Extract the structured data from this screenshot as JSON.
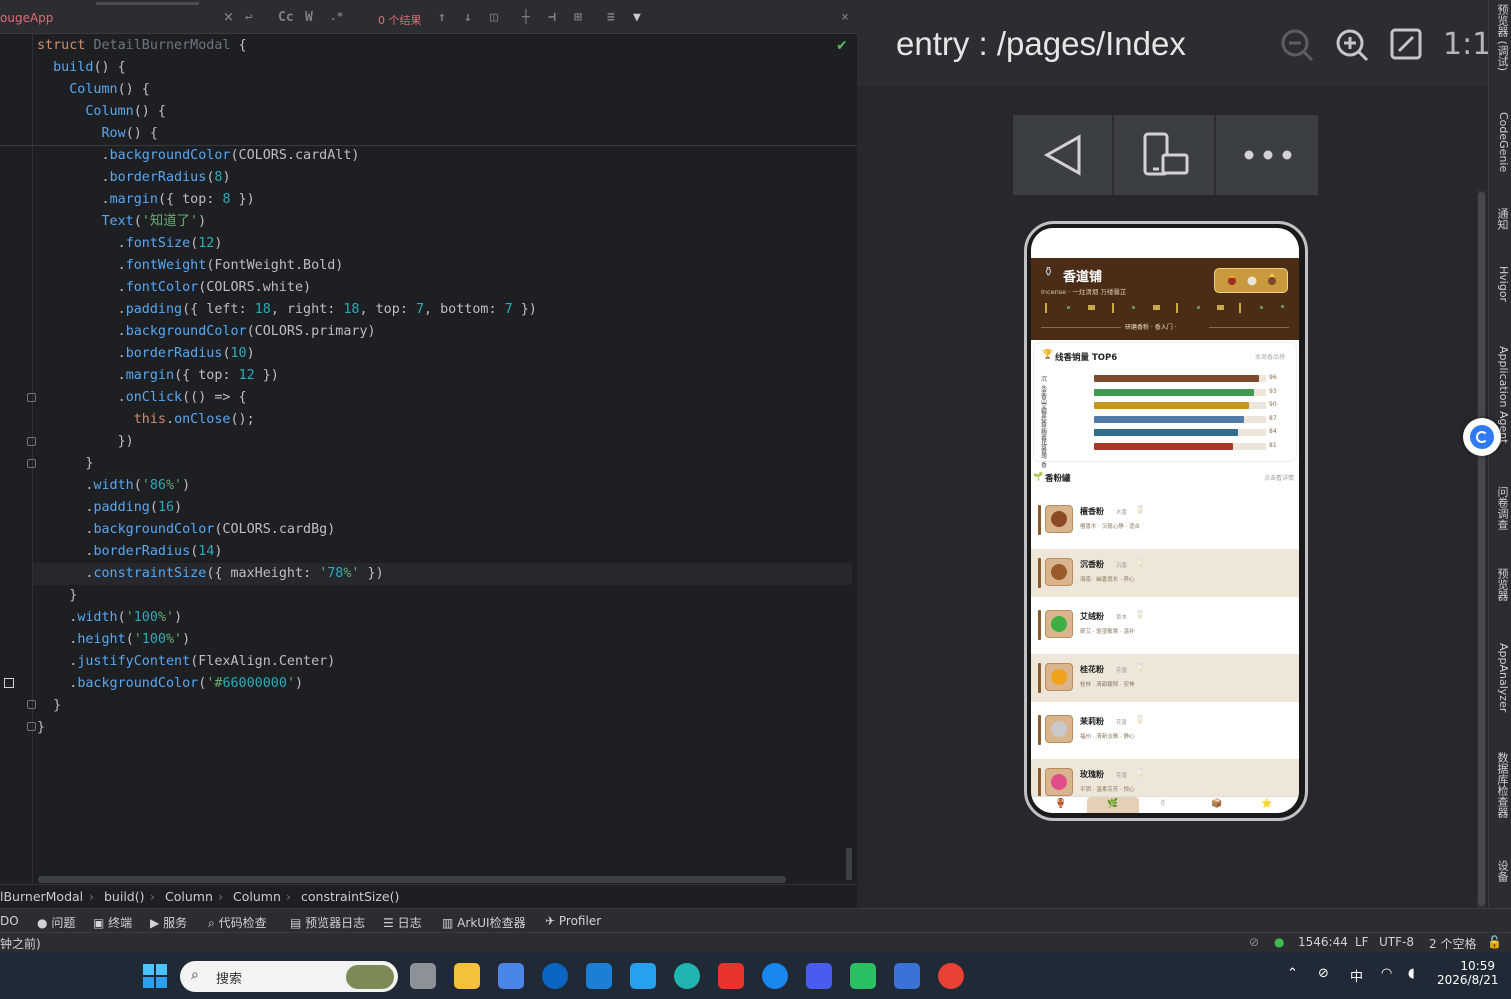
{
  "editor": {
    "file_tab": "ougeApp",
    "find_results": "0 个结果",
    "find_buttons": {
      "case": "Cc",
      "word": "W",
      "regex": ".*"
    },
    "code_lines": [
      "struct DetailBurnerModal {",
      "  build() {",
      "    Column() {",
      "      Column() {",
      "        Row() {",
      "        .backgroundColor(COLORS.cardAlt)",
      "        .borderRadius(8)",
      "        .margin({ top: 8 })",
      "        Text('知道了')",
      "          .fontSize(12)",
      "          .fontWeight(FontWeight.Bold)",
      "          .fontColor(COLORS.white)",
      "          .padding({ left: 18, right: 18, top: 7, bottom: 7 })",
      "          .backgroundColor(COLORS.primary)",
      "          .borderRadius(10)",
      "          .margin({ top: 12 })",
      "          .onClick(() => {",
      "            this.onClose();",
      "          })",
      "      }",
      "      .width('86%')",
      "      .padding(16)",
      "      .backgroundColor(COLORS.cardBg)",
      "      .borderRadius(14)",
      "      .constraintSize({ maxHeight: '78%' })",
      "    }",
      "    .width('100%')",
      "    .height('100%')",
      "    .justifyContent(FlexAlign.Center)",
      "    .backgroundColor('#66000000')",
      "  }",
      "}"
    ],
    "breadcrumb": [
      "lBurnerModal",
      "build()",
      "Column",
      "Column",
      "constraintSize()"
    ]
  },
  "preview": {
    "title": "entry : /pages/Index",
    "zoom_fit": "1:1",
    "phone": {
      "brand": "香道铺",
      "brand_sub": "Incense · 一炷清烟 万缕馨芷",
      "banner_bottom": "研磨香粉 · 香入门 ·",
      "ranking": {
        "title": "线香销量 TOP6",
        "subtitle": "本周香品榜",
        "items": [
          {
            "label": "沉水香",
            "value": 96,
            "color": "#7b4a2c"
          },
          {
            "label": "老山檀",
            "value": 93,
            "color": "#3e9b4f"
          },
          {
            "label": "艾草香",
            "value": 90,
            "color": "#c8951f"
          },
          {
            "label": "桂花香",
            "value": 87,
            "color": "#4f7aa8"
          },
          {
            "label": "梅花香",
            "value": 84,
            "color": "#2f6d8a"
          },
          {
            "label": "玫瑰香",
            "value": 81,
            "color": "#a8362b"
          }
        ]
      },
      "section": {
        "title": "香粉罐",
        "subtitle": "点击看详情"
      },
      "products": [
        {
          "name": "檀香粉",
          "tag": "木香",
          "desc": "檀香木 · 沉稳心静 · 适合",
          "dot": "#8b4a25",
          "bg": "#ffffff"
        },
        {
          "name": "沉香粉",
          "tag": "沉香",
          "desc": "海南 · 幽香悠长 · 养心",
          "dot": "#9a5a2a",
          "bg": "#efe6da"
        },
        {
          "name": "艾绒粉",
          "tag": "草本",
          "desc": "蕲艾 · 驱湿散寒 · 温补",
          "dot": "#3cb043",
          "bg": "#ffffff"
        },
        {
          "name": "桂花粉",
          "tag": "花香",
          "desc": "桂林 · 清甜馥郁 · 安神",
          "dot": "#f0a21a",
          "bg": "#efe6da"
        },
        {
          "name": "茉莉粉",
          "tag": "花香",
          "desc": "福州 · 清新淡雅 · 静心",
          "dot": "#c9c9c9",
          "bg": "#ffffff"
        },
        {
          "name": "玫瑰粉",
          "tag": "花香",
          "desc": "平阴 · 温柔芬芳 · 悦心",
          "dot": "#e04e8a",
          "bg": "#efe6da"
        }
      ]
    }
  },
  "rail": [
    "预览器 (调试)",
    "CodeGenie",
    "通知",
    "Hvigor",
    "Application Agent",
    "问卷调查",
    "预览器",
    "AppAnalyzer",
    "数据库检查器",
    "设备"
  ],
  "toolstrip": [
    "DO",
    "问题",
    "终端",
    "服务",
    "代码检查",
    "预览器日志",
    "日志",
    "ArkUI检查器",
    "Profiler"
  ],
  "status": {
    "left": "钟之前)",
    "position": "1546:44",
    "line_sep": "LF",
    "encoding": "UTF-8",
    "indent": "2 个空格"
  },
  "taskbar": {
    "search_placeholder": "搜索",
    "ime": "中",
    "time": "10:59",
    "date": "2026/8/21"
  }
}
